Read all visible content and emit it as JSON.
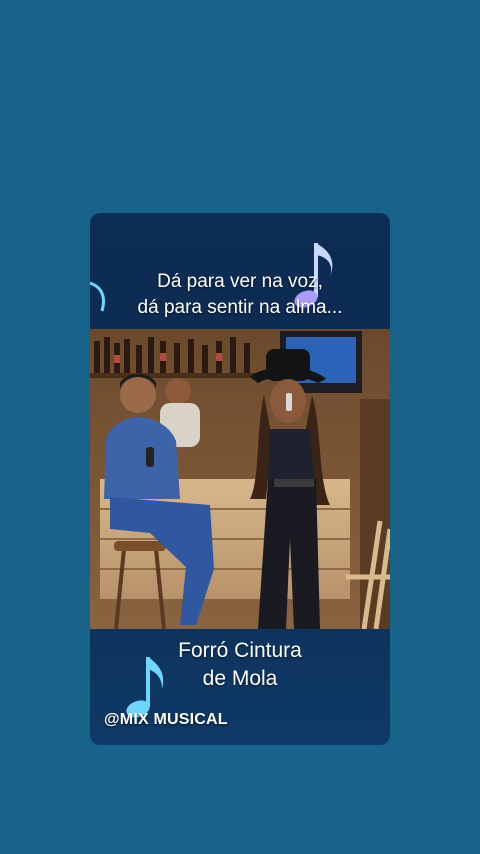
{
  "post": {
    "caption_line1": "Dá para ver na voz,",
    "caption_line2": "dá para sentir na alma...",
    "title_line1": "Forró Cintura",
    "title_line2": "de Mola",
    "watermark": "@MIX MUSICAL"
  },
  "colors": {
    "page_background": "#17638a",
    "card_background": "#0d2d55",
    "note_accent": "#6fd6ff"
  },
  "icons": [
    "music-note-icon"
  ]
}
